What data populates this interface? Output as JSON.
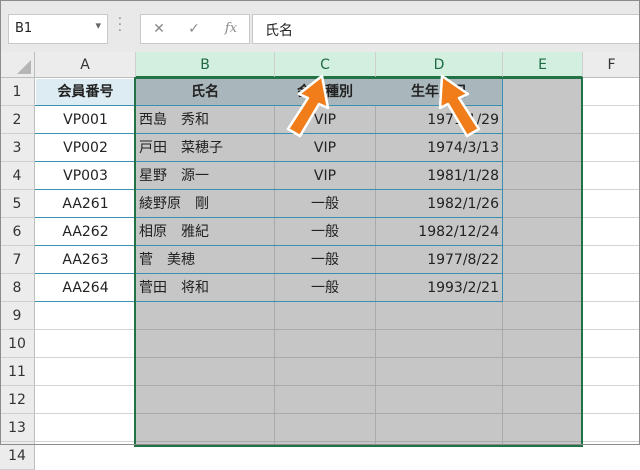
{
  "namebox": {
    "value": "B1"
  },
  "formula_bar": {
    "cancel_icon": "✕",
    "enter_icon": "✓",
    "fx_label": "fx",
    "value": "氏名"
  },
  "columns": [
    "A",
    "B",
    "C",
    "D",
    "E",
    "F"
  ],
  "rows": [
    "1",
    "2",
    "3",
    "4",
    "5",
    "6",
    "7",
    "8",
    "9",
    "10",
    "11",
    "12",
    "13",
    "14"
  ],
  "table": {
    "headers": [
      "会員番号",
      "氏名",
      "会員種別",
      "生年月日"
    ],
    "rows": [
      [
        "VP001",
        "西島　秀和",
        "VIP",
        "1971/1/29"
      ],
      [
        "VP002",
        "戸田　菜穂子",
        "VIP",
        "1974/3/13"
      ],
      [
        "VP003",
        "星野　源一",
        "VIP",
        "1981/1/28"
      ],
      [
        "AA261",
        "綾野原　剛",
        "一般",
        "1982/1/26"
      ],
      [
        "AA262",
        "相原　雅紀",
        "一般",
        "1982/12/24"
      ],
      [
        "AA263",
        "菅　美穂",
        "一般",
        "1977/8/22"
      ],
      [
        "AA264",
        "菅田　将和",
        "一般",
        "1993/2/21"
      ]
    ]
  },
  "colors": {
    "selection_border": "#217346",
    "selection_fill": "#c6c6c6",
    "table_border": "#3b8fb0",
    "arrow": "#f07d1a"
  }
}
